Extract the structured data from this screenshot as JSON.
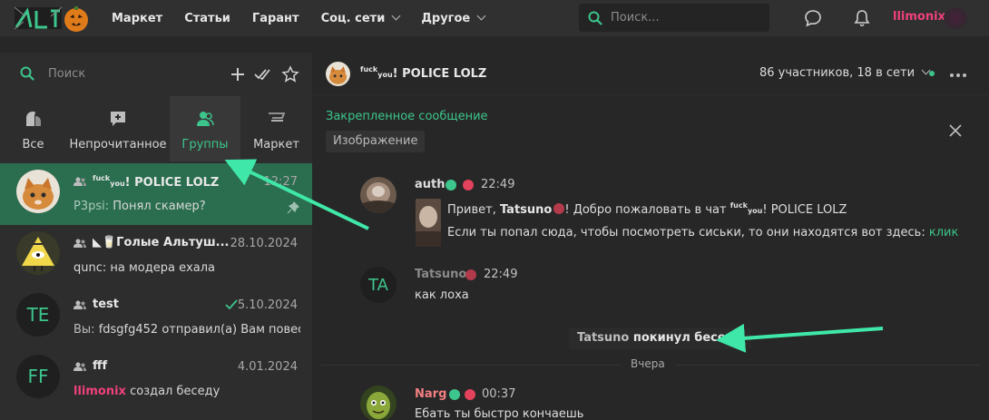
{
  "topbar": {
    "nav": [
      "Маркет",
      "Статьи",
      "Гарант",
      "Соц. сети",
      "Другое"
    ],
    "search_placeholder": "Поиск...",
    "username": "llimonix"
  },
  "sidebar": {
    "search_placeholder": "Поиск",
    "categories": [
      "Все",
      "Непрочитанное",
      "Группы",
      "Маркет"
    ],
    "conversations": [
      {
        "name_sup": "fuck",
        "name_sub": "you",
        "name_rest": "! POLICE LOLZ",
        "time": "12:27",
        "prefix": "P3psi:",
        "message": "Понял скамер?"
      },
      {
        "name": "◣🥛Голые Альтуш...",
        "time": "28.10.2024",
        "message": "qunc: на модера ехала"
      },
      {
        "initials": "TE",
        "name": "test",
        "time": "5.10.2024",
        "prefix": "Вы:",
        "message": "fdsgfg452 отправил(а) Вам повес..."
      },
      {
        "initials": "FF",
        "name": "fff",
        "time": "4.01.2024",
        "author": "llimonix",
        "message": "создал беседу"
      }
    ]
  },
  "chat": {
    "title_sup": "fuck",
    "title_sub": "you",
    "title_rest": "! POLICE LOLZ",
    "members": "86 участников, 18 в сети",
    "pinned_title": "Закрепленное сообщение",
    "pinned_badge": "Изображение",
    "messages": [
      {
        "author": "auth",
        "time": "22:49",
        "line1_pre": "Привет,",
        "line1_mention": "Tatsuno",
        "line1_mid": "! Добро пожаловать в чат",
        "line1_sup": "fuck",
        "line1_sub": "you",
        "line1_rest": "! POLICE LOLZ",
        "line2": "Если ты попал сюда, чтобы посмотреть сиськи, то они находятся вот здесь:",
        "line2_link": "клик"
      },
      {
        "initials": "TA",
        "author": "Tatsuno",
        "time": "22:49",
        "text": "как лоха"
      },
      {
        "author": "Narg",
        "time": "00:37",
        "text": "Ебать ты быстро кончаешь"
      }
    ],
    "system_user": "Tatsuno",
    "system_text": "покинул беседу",
    "day_label": "Вчера"
  },
  "colors": {
    "accent": "#3cc58c",
    "pink": "#f0417a",
    "red": "#e2425b"
  }
}
